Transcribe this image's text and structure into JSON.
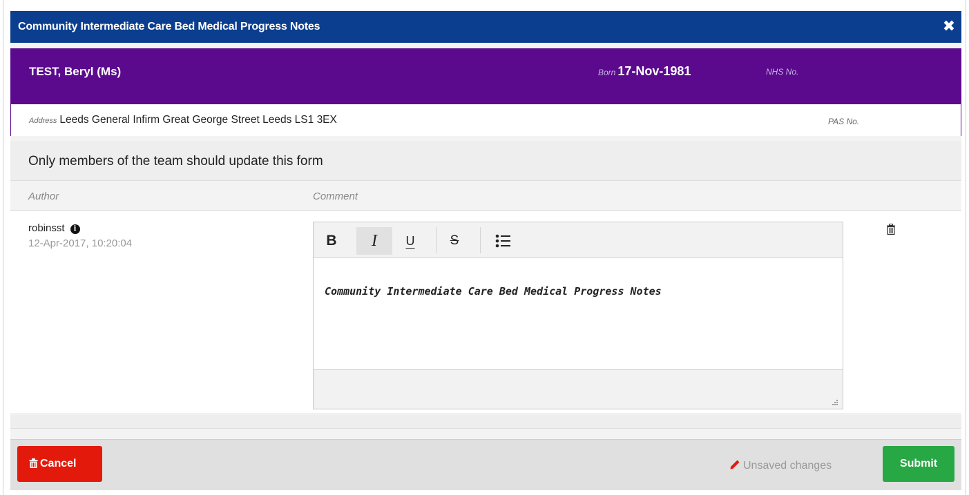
{
  "dialog": {
    "title": "Community Intermediate Care Bed Medical Progress Notes",
    "close_glyph": "✖"
  },
  "patient": {
    "name": "TEST, Beryl (Ms)",
    "born_label": "Born",
    "born_value": "17-Nov-1981",
    "nhs_label": "NHS No.",
    "address_label": "Address",
    "address_value": "Leeds General Infirm Great George Street Leeds LS1 3EX",
    "pas_label": "PAS No."
  },
  "notice": "Only members of the team should update this form",
  "columns": {
    "author": "Author",
    "comment": "Comment"
  },
  "entry": {
    "author": "robinsst",
    "timestamp": "12-Apr-2017, 10:20:04",
    "comment_text": "Community Intermediate Care Bed Medical Progress Notes"
  },
  "toolbar": {
    "bold": "B",
    "italic": "I",
    "underline": "U",
    "strike": "S",
    "italic_active": true
  },
  "footer": {
    "cancel_label": "Cancel",
    "unsaved_label": "Unsaved changes",
    "submit_label": "Submit"
  },
  "colors": {
    "titlebar": "#0b3e8f",
    "banner": "#5b0a8e",
    "cancel": "#e31a0b",
    "submit": "#28a745"
  }
}
